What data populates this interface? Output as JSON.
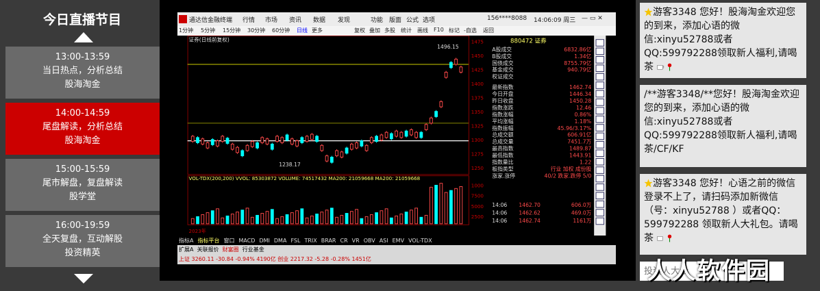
{
  "schedule": {
    "title": "今日直播节目",
    "programs": [
      {
        "time": "13:00-13:59",
        "desc": "当日热点，分析总结",
        "host": "股海淘金",
        "active": false
      },
      {
        "time": "14:00-14:59",
        "desc": "尾盘解读，分析总结",
        "host": "股海淘金",
        "active": true
      },
      {
        "time": "15:00-15:59",
        "desc": "尾市解盘，复盘解读",
        "host": "股学堂",
        "active": false
      },
      {
        "time": "16:00-19:59",
        "desc": "全天复盘，互动解股",
        "host": "投资精英",
        "active": false
      }
    ]
  },
  "terminal": {
    "menu": [
      "通达信金融终端",
      "行情",
      "市场",
      "资讯",
      "数据",
      "发现",
      "功能",
      "版面",
      "公式",
      "选项"
    ],
    "account": "156****8088",
    "clock": "14:06:09 周三",
    "periods": [
      "1分钟",
      "5分钟",
      "15分钟",
      "30分钟",
      "60分钟",
      "日线",
      "更多"
    ],
    "tools": [
      "复权",
      "叠加",
      "多股",
      "统计",
      "画线",
      "F10",
      "标记",
      "-自选",
      "返回"
    ],
    "chart_label": "证券(日线前复权)",
    "high_label": "1496.15",
    "low_label": "1238.17",
    "y_ticks": [
      "1475",
      "1450",
      "1425",
      "1400",
      "1375",
      "1350",
      "1325",
      "1300",
      "1275",
      "1250"
    ],
    "vol_label": "VOL-TDX(200,200) VVOL: 85303872 VOLUME: 74517432 MA200: 21059668 MA200: 21059668",
    "vol_ticks": [
      "1000",
      "7500",
      "5000",
      "2500"
    ],
    "code": "880472 证券",
    "quote": [
      {
        "k": "A股成交",
        "v": "6832.86亿"
      },
      {
        "k": "B股成交",
        "v": "1.34亿"
      },
      {
        "k": "国债成交",
        "v": "8755.79亿"
      },
      {
        "k": "基金成交",
        "v": "940.79亿"
      },
      {
        "k": "权证成交",
        "v": ""
      },
      {
        "k": "最新指数",
        "v": "1462.74"
      },
      {
        "k": "今日开盘",
        "v": "1446.34"
      },
      {
        "k": "昨日收盘",
        "v": "1450.28"
      },
      {
        "k": "指数涨跌",
        "v": "12.46"
      },
      {
        "k": "指数涨幅",
        "v": "0.86%"
      },
      {
        "k": "平均涨幅",
        "v": "1.18%"
      },
      {
        "k": "指数振幅",
        "v": "45.96/3.17%"
      },
      {
        "k": "总成交额",
        "v": "606.91亿"
      },
      {
        "k": "总成交量",
        "v": "7451.7万"
      },
      {
        "k": "最高指数",
        "v": "1489.87"
      },
      {
        "k": "最低指数",
        "v": "1443.91"
      },
      {
        "k": "指数量比",
        "v": "1.22"
      },
      {
        "k": "板指类型",
        "v": "行业 加权 成份股"
      },
      {
        "k": "涨家.涨停",
        "v": "40/2 跌家.跌停 5/0"
      }
    ],
    "ticks": [
      {
        "t": "14:06",
        "p": "1462.70",
        "v": "606.0万"
      },
      {
        "t": "14:06",
        "p": "1462.62",
        "v": "469.0万"
      },
      {
        "t": "14:06",
        "p": "1462.74",
        "v": "1161万"
      }
    ],
    "tabs": [
      "指标A",
      "指标平台",
      "窗口",
      "MACD",
      "DMI",
      "DMA",
      "FSL",
      "TRIX",
      "BRAR",
      "CR",
      "VR",
      "OBV",
      "ASI",
      "EMV",
      "VOL-TDX"
    ],
    "tabs2": [
      "扩展A",
      "关联报价",
      "财富圈",
      "行业基金"
    ],
    "status": "上证 3260.11 -30.84 -0.94% 4190亿 创业 2217.32 -5.28 -0.28% 1451亿",
    "year_label": "2023年"
  },
  "chat": {
    "messages": [
      {
        "text": "游客3348 您好！股海淘金欢迎您的到来，添加心语的微信:xinyu52788或者QQ:599792288领取新人福利,请喝茶"
      },
      {
        "text": "/**游客3348/**您好！股海淘金欢迎您的到来，添加心语的微信:xinyu52788或者QQ:599792288领取新人福利,请喝茶/CF/KF"
      },
      {
        "text": "游客3348 您好！心语之前的微信登录不上了，请扫码添加新微信（号：xinyu52788 ）或者QQ：599792288 领取新人大礼包。请喝茶"
      }
    ],
    "input_placeholder": "投资人大会",
    "watermark": "人人软件园"
  }
}
